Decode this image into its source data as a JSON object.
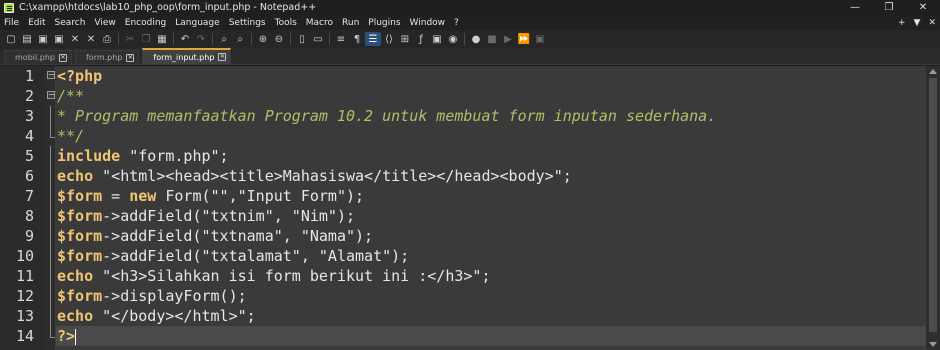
{
  "window": {
    "title": "C:\\xampp\\htdocs\\lab10_php_oop\\form_input.php - Notepad++",
    "controls": [
      "—",
      "❐",
      "✕"
    ]
  },
  "menu": {
    "items": [
      "File",
      "Edit",
      "Search",
      "View",
      "Encoding",
      "Language",
      "Settings",
      "Tools",
      "Macro",
      "Run",
      "Plugins",
      "Window",
      "?"
    ],
    "right": [
      "+",
      "▼",
      "✕"
    ]
  },
  "tabs": [
    {
      "label": "mobil.php",
      "active": false
    },
    {
      "label": "form.php",
      "active": false
    },
    {
      "label": "form_input.php",
      "active": true
    }
  ],
  "editor": {
    "current_line": 14,
    "lines": [
      {
        "num": "1",
        "fold": "box-minus",
        "tokens": [
          {
            "t": "<?php",
            "c": "php"
          }
        ]
      },
      {
        "num": "2",
        "fold": "box-minus",
        "tokens": [
          {
            "t": "/**",
            "c": "cmt"
          }
        ]
      },
      {
        "num": "3",
        "fold": "line",
        "tokens": [
          {
            "t": "* Program memanfaatkan Program 10.2 untuk membuat form inputan sederhana.",
            "c": "cmt"
          }
        ]
      },
      {
        "num": "4",
        "fold": "end",
        "tokens": [
          {
            "t": "**/",
            "c": "cmt"
          }
        ]
      },
      {
        "num": "5",
        "fold": "line",
        "tokens": [
          {
            "t": "include",
            "c": "kw"
          },
          {
            "t": " \"form.php\";",
            "c": "str"
          }
        ]
      },
      {
        "num": "6",
        "fold": "line",
        "tokens": [
          {
            "t": "echo",
            "c": "kw"
          },
          {
            "t": " \"<html><head><title>Mahasiswa</title></head><body>\";",
            "c": "str"
          }
        ]
      },
      {
        "num": "7",
        "fold": "line",
        "tokens": [
          {
            "t": "$form",
            "c": "var"
          },
          {
            "t": " = ",
            "c": "op"
          },
          {
            "t": "new",
            "c": "kw"
          },
          {
            "t": " Form(\"\",\"Input Form\");",
            "c": "plain"
          }
        ]
      },
      {
        "num": "8",
        "fold": "line",
        "tokens": [
          {
            "t": "$form",
            "c": "var"
          },
          {
            "t": "->addField(\"txtnim\", \"Nim\");",
            "c": "plain"
          }
        ]
      },
      {
        "num": "9",
        "fold": "line",
        "tokens": [
          {
            "t": "$form",
            "c": "var"
          },
          {
            "t": "->addField(\"txtnama\", \"Nama\");",
            "c": "plain"
          }
        ]
      },
      {
        "num": "10",
        "fold": "line",
        "tokens": [
          {
            "t": "$form",
            "c": "var"
          },
          {
            "t": "->addField(\"txtalamat\", \"Alamat\");",
            "c": "plain"
          }
        ]
      },
      {
        "num": "11",
        "fold": "line",
        "tokens": [
          {
            "t": "echo",
            "c": "kw"
          },
          {
            "t": " \"<h3>Silahkan isi form berikut ini :</h3>\";",
            "c": "str"
          }
        ]
      },
      {
        "num": "12",
        "fold": "line",
        "tokens": [
          {
            "t": "$form",
            "c": "var"
          },
          {
            "t": "->displayForm();",
            "c": "plain"
          }
        ]
      },
      {
        "num": "13",
        "fold": "line",
        "tokens": [
          {
            "t": "echo",
            "c": "kw"
          },
          {
            "t": " \"</body></html>\";",
            "c": "str"
          }
        ]
      },
      {
        "num": "14",
        "fold": "end",
        "tokens": [
          {
            "t": "?>",
            "c": "php"
          }
        ]
      }
    ]
  },
  "toolbar": {
    "icons": [
      {
        "name": "new-file-icon",
        "glyph": "▢"
      },
      {
        "name": "open-file-icon",
        "glyph": "▤"
      },
      {
        "name": "save-icon",
        "glyph": "▣"
      },
      {
        "name": "save-all-icon",
        "glyph": "▣"
      },
      {
        "name": "close-icon",
        "glyph": "✕"
      },
      {
        "name": "close-all-icon",
        "glyph": "✕"
      },
      {
        "name": "print-icon",
        "glyph": "⎙"
      },
      {
        "sep": true
      },
      {
        "name": "cut-icon",
        "glyph": "✂",
        "dim": true
      },
      {
        "name": "copy-icon",
        "glyph": "❐",
        "dim": true
      },
      {
        "name": "paste-icon",
        "glyph": "▦"
      },
      {
        "sep": true
      },
      {
        "name": "undo-icon",
        "glyph": "↶"
      },
      {
        "name": "redo-icon",
        "glyph": "↷",
        "dim": true
      },
      {
        "sep": true
      },
      {
        "name": "find-icon",
        "glyph": "⌕"
      },
      {
        "name": "replace-icon",
        "glyph": "⌕"
      },
      {
        "sep": true
      },
      {
        "name": "zoom-in-icon",
        "glyph": "⊕"
      },
      {
        "name": "zoom-out-icon",
        "glyph": "⊖"
      },
      {
        "sep": true
      },
      {
        "name": "sync-vertical-icon",
        "glyph": "▯"
      },
      {
        "name": "sync-horizontal-icon",
        "glyph": "▭"
      },
      {
        "sep": true
      },
      {
        "name": "word-wrap-icon",
        "glyph": "≡"
      },
      {
        "name": "show-all-chars-icon",
        "glyph": "¶"
      },
      {
        "name": "indent-guide-icon",
        "glyph": "☰",
        "hl": true
      },
      {
        "name": "xml-tag-icon",
        "glyph": "⟨⟩"
      },
      {
        "name": "document-map-icon",
        "glyph": "⊞"
      },
      {
        "name": "function-list-icon",
        "glyph": "ƒ"
      },
      {
        "name": "folder-workspace-icon",
        "glyph": "▣"
      },
      {
        "name": "monitoring-icon",
        "glyph": "◉"
      },
      {
        "sep": true
      },
      {
        "name": "record-macro-icon",
        "glyph": "●"
      },
      {
        "name": "stop-record-icon",
        "glyph": "■",
        "dim": true
      },
      {
        "name": "play-macro-icon",
        "glyph": "▶",
        "dim": true
      },
      {
        "name": "run-macro-multiple-icon",
        "glyph": "⏩"
      },
      {
        "name": "save-macro-icon",
        "glyph": "▣",
        "dim": true
      }
    ]
  }
}
